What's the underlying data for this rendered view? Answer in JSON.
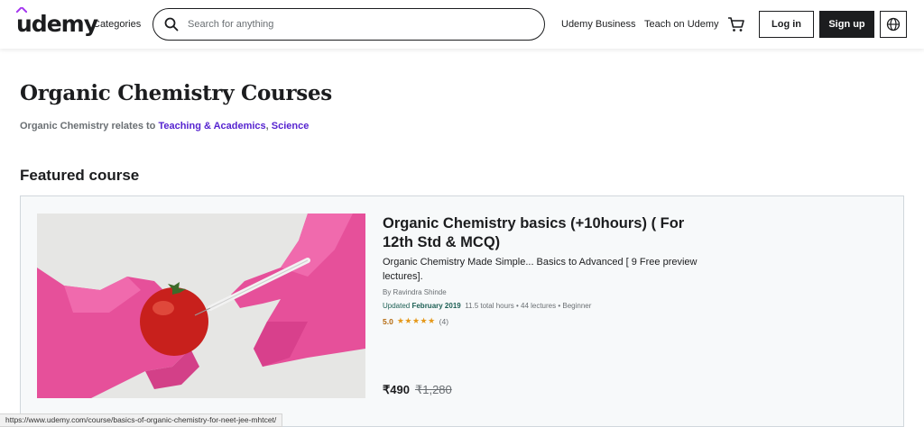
{
  "header": {
    "logo": "udemy",
    "categories_label": "Categories",
    "search_placeholder": "Search for anything",
    "search_value": "",
    "udemy_business_label": "Udemy Business",
    "teach_label": "Teach on Udemy",
    "login_label": "Log in",
    "signup_label": "Sign up"
  },
  "page": {
    "title": "Organic Chemistry Courses",
    "relates_prefix": "Organic Chemistry relates to ",
    "relates_link1": "Teaching & Academics",
    "relates_sep": ", ",
    "relates_link2": "Science",
    "featured_heading": "Featured course"
  },
  "course": {
    "title": "Organic Chemistry basics (+10hours) ( For 12th Std & MCQ)",
    "description": "Organic Chemistry Made Simple... Basics to Advanced [ 9 Free preview lectures].",
    "author": "By Ravindra Shinde",
    "updated_label": "Updated ",
    "updated_date": "February 2019",
    "details": "11.5 total hours • 44 lectures • Beginner",
    "rating": "5.0",
    "stars": "★★★★★",
    "rating_count": "(4)",
    "price": "₹490",
    "original_price": "₹1,280"
  },
  "status_bar": {
    "url": "https://www.udemy.com/course/basics-of-organic-chemistry-for-neet-jee-mhtcet/"
  },
  "colors": {
    "accent_link": "#5624d0",
    "rating": "#b4690e",
    "star": "#e59819",
    "updated": "#1e6055"
  },
  "icons": [
    "search-icon",
    "cart-icon",
    "globe-icon"
  ]
}
